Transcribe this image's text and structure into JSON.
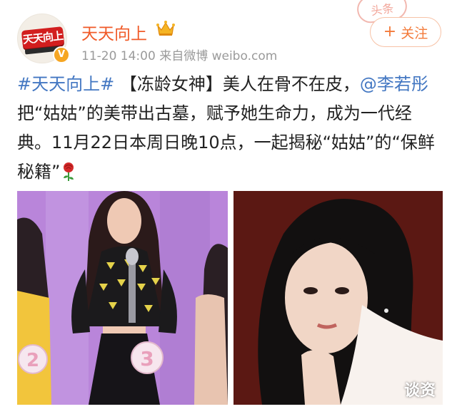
{
  "account": {
    "name": "天天向上",
    "avatar_text": "天天向上",
    "verified_badge": "V",
    "meta": "11-20 14:00  来自微博 weibo.com"
  },
  "follow_button": {
    "plus": "+",
    "label": "关注"
  },
  "post": {
    "hashtag": "#天天向上#",
    "text_1": " 【冻龄女神】美人在骨不在皮，",
    "mention": "@李若彤",
    "text_2": " 把“姑姑”的美带出古墓，赋予她生命力，成为一代经典。11月22日本周日晚10点，一起揭秘“姑姑”的“保鲜秘籍”"
  },
  "photos": {
    "left_number_badge": "3",
    "left_side_badge": "2"
  },
  "watermarks": {
    "top": "头条",
    "bottom": "谈资"
  },
  "colors": {
    "username": "#f05a28",
    "link": "#4377c2",
    "follow": "#f37a3a"
  },
  "icons": {
    "crown": "crown-icon",
    "rose": "rose-icon",
    "verified": "verified-badge-icon"
  }
}
